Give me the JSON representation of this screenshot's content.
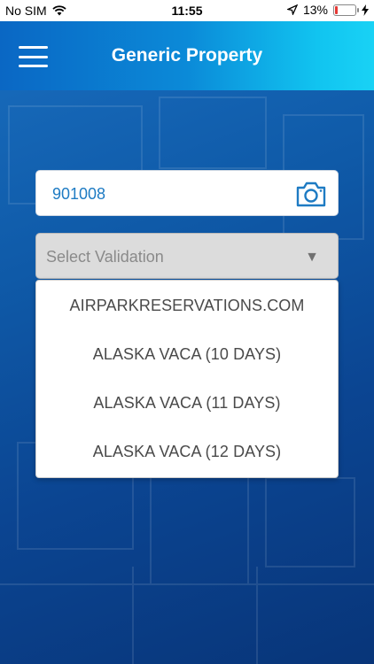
{
  "status_bar": {
    "carrier": "No SIM",
    "time": "11:55",
    "battery_percent": "13%",
    "battery_level": 0.13,
    "icons": [
      "wifi-icon",
      "location-arrow-icon",
      "battery-icon",
      "charging-bolt-icon"
    ]
  },
  "header": {
    "title": "Generic Property",
    "menu_icon": "hamburger-menu-icon"
  },
  "code_field": {
    "value": "901008",
    "icon": "camera-icon"
  },
  "validation_select": {
    "placeholder": "Select Validation",
    "arrow": "▼",
    "options": [
      "AIRPARKRESERVATIONS.COM",
      "ALASKA VACA (10 DAYS)",
      "ALASKA VACA (11 DAYS)",
      "ALASKA VACA (12 DAYS)"
    ]
  },
  "colors": {
    "header_gradient_start": "#0a67c4",
    "header_gradient_end": "#19d2f5",
    "background": "#0b4592",
    "code_text": "#1e7bc3",
    "battery_low": "#e53935"
  }
}
